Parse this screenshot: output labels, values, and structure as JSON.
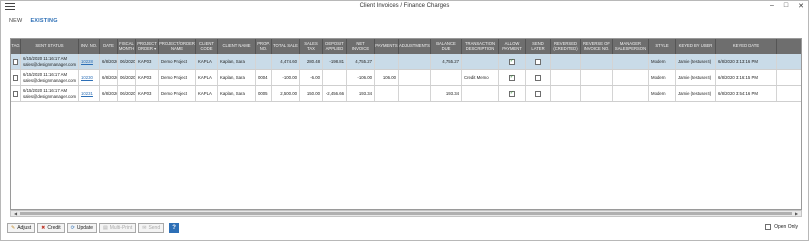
{
  "window": {
    "title": "Client Invoices / Finance Charges",
    "min": "–",
    "max": "□",
    "close": "✕"
  },
  "tabs": [
    {
      "label": "NEW"
    },
    {
      "label": "EXISTING"
    }
  ],
  "columns": [
    "TAG",
    "SENT STATUS",
    "INV. NO.",
    "DATE",
    "FISCAL MONTH",
    "PROJECT ORDER ▾",
    "PROJECT/ORDER NAME",
    "CLIENT CODE",
    "CLIENT NAME",
    "PROP. NO.",
    "TOTAL SALE",
    "SALES TAX",
    "DEPOSIT APPLIED",
    "NET INVOICE",
    "PAYMENTS",
    "ADJUSTMENTS",
    "BALANCE DUE",
    "TRANSACTION DESCRIPTION",
    "ALLOW PAYMENT",
    "SEND LATER",
    "REVERSED (CREDITED)",
    "REVERSE OF INVOICE NO.",
    "MANAGER SALESPERSON",
    "STYLE",
    "KEYED BY USER",
    "KEYED DATE"
  ],
  "rows": [
    {
      "sent1": "6/15/2020 11:16:17 AM",
      "sent2": "sales@designmanager.com",
      "inv": "10228",
      "date": "6/8/2020",
      "fiscal": "06/2020",
      "project": "KAP03",
      "pname": "Demo Project",
      "ccode": "KAPLA",
      "cname": "Kaplan, Sara",
      "prop": "",
      "total": "4,474.60",
      "tax": "280.48",
      "deposit": "-198.81",
      "net": "4,755.27",
      "payments": "",
      "adj": "",
      "balance": "4,755.27",
      "desc": "",
      "allow": "✓",
      "later": "",
      "reversed": "",
      "revinv": "",
      "manager": "",
      "style": "Modern",
      "user": "Jamie (testuser4)",
      "kdate": "6/8/2020 3:13:16 PM"
    },
    {
      "sent1": "6/15/2020 11:16:17 AM",
      "sent2": "sales@designmanager.com",
      "inv": "10230",
      "date": "6/8/2020",
      "fiscal": "06/2020",
      "project": "KAP03",
      "pname": "Demo Project",
      "ccode": "KAPLA",
      "cname": "Kaplan, Sara",
      "prop": "0004",
      "total": "-100.00",
      "tax": "-6.00",
      "deposit": "",
      "net": "-106.00",
      "payments": "106.00",
      "adj": "",
      "balance": "",
      "desc": "Credit Memo",
      "allow": "✓",
      "later": "",
      "reversed": "",
      "revinv": "",
      "manager": "",
      "style": "Modern",
      "user": "Jamie (testuser4)",
      "kdate": "6/8/2020 3:16:15 PM"
    },
    {
      "sent1": "6/15/2020 11:16:17 AM",
      "sent2": "sales@designmanager.com",
      "inv": "10231",
      "date": "6/8/2020",
      "fiscal": "06/2020",
      "project": "KAP03",
      "pname": "Demo Project",
      "ccode": "KAPLA",
      "cname": "Kaplan, Sara",
      "prop": "0005",
      "total": "2,500.00",
      "tax": "150.00",
      "deposit": "-2,456.66",
      "net": "193.34",
      "payments": "",
      "adj": "",
      "balance": "193.34",
      "desc": "",
      "allow": "✓",
      "later": "",
      "reversed": "",
      "revinv": "",
      "manager": "",
      "style": "Modern",
      "user": "Jamie (testuser4)",
      "kdate": "6/8/2020 3:54:16 PM"
    }
  ],
  "footer": {
    "adjust": "Adjust",
    "credit": "Credit",
    "update": "Update",
    "multi": "Multi-Print",
    "send": "Send",
    "help": "?",
    "open_only": "Open Only"
  },
  "colors": {
    "accent": "#2d6fb6",
    "header_bg": "#6e6e6e",
    "selected_row": "#c9dbe8"
  }
}
